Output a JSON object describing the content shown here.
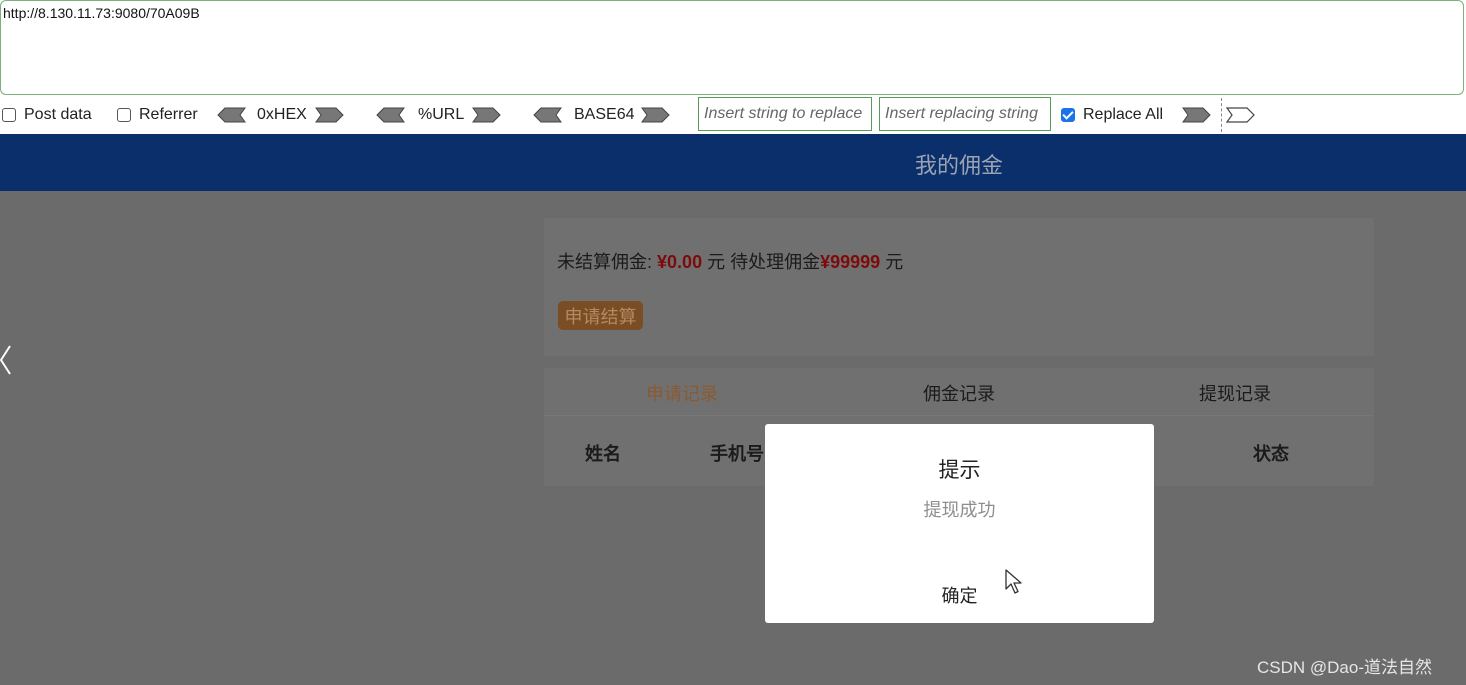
{
  "hackbar": {
    "url": "http://8.130.11.73:9080/70A09B",
    "post_data_label": "Post data",
    "referrer_label": "Referrer",
    "hex_label": "0xHEX",
    "url_label": "%URL",
    "base64_label": "BASE64",
    "find_placeholder": "Insert string to replace",
    "replace_placeholder": "Insert replacing string",
    "replace_all_label": "Replace All",
    "post_data_checked": false,
    "referrer_checked": false,
    "replace_all_checked": true
  },
  "page": {
    "header_title": "我的佣金",
    "unsettled_label": "未结算佣金:",
    "unsettled_amount": "¥0.00",
    "unit_1": "元",
    "pending_label": "待处理佣金",
    "pending_amount": "¥99999",
    "unit_2": "元",
    "apply_button": "申请结算",
    "tabs": [
      "申请记录",
      "佣金记录",
      "提现记录"
    ],
    "active_tab": 0,
    "columns": [
      "姓名",
      "手机号",
      "状态"
    ]
  },
  "modal": {
    "title": "提示",
    "message": "提现成功",
    "confirm": "确定"
  },
  "watermark": "CSDN @Dao-道法自然",
  "colors": {
    "header_bg": "#0b2f6b",
    "money": "#7d0b0b",
    "apply_button_bg": "#7a4d24",
    "active_tab": "#8a5a32",
    "overlay": "#6b6b6b"
  }
}
